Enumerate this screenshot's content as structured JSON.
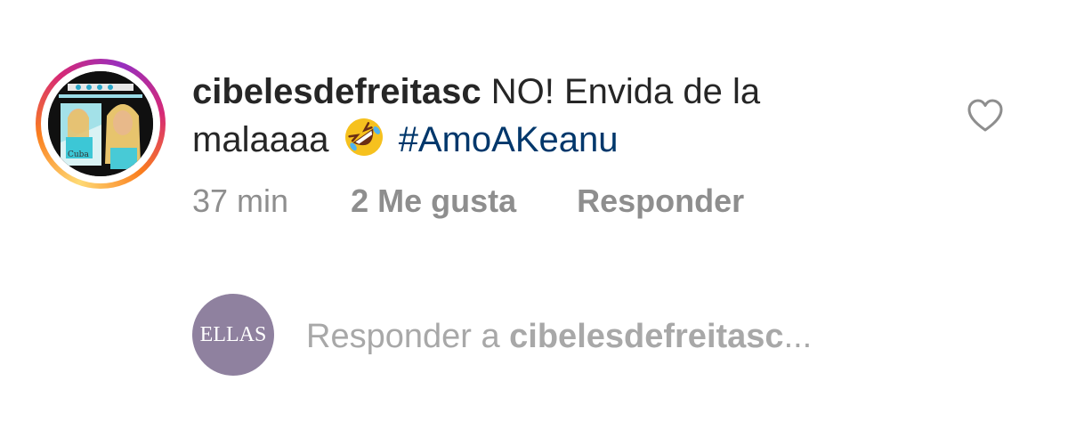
{
  "comment": {
    "username": "cibelesdefreitasc",
    "text_before_emoji": "NO! Envida de la malaaaa",
    "emoji": "rolling-on-floor-laughing-emoji",
    "hashtag": "#AmoAKeanu",
    "time": "37 min",
    "likes": "2 Me gusta",
    "reply_label": "Responder"
  },
  "reply_box": {
    "avatar_text": "ELLAS",
    "placeholder_prefix": "Responder a ",
    "placeholder_target": "cibelesdefreitasc",
    "placeholder_suffix": "..."
  },
  "colors": {
    "text": "#262626",
    "muted": "#8e8e8e",
    "hashtag": "#00376b",
    "reply_avatar_bg": "#8f819f"
  },
  "icons": {
    "like": "heart-outline-icon"
  }
}
